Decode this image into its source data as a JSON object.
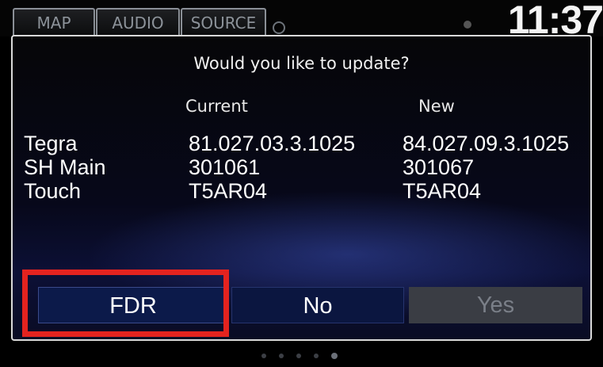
{
  "tabs": {
    "map": "MAP",
    "audio": "AUDIO",
    "source": "SOURCE"
  },
  "clock": "11:37",
  "dialog": {
    "question": "Would you like to update?",
    "current_header": "Current",
    "new_header": "New",
    "rows": [
      {
        "name": "Tegra",
        "current": "81.027.03.3.1025",
        "new": "84.027.09.3.1025"
      },
      {
        "name": "SH Main",
        "current": "301061",
        "new": "301067"
      },
      {
        "name": "Touch",
        "current": "T5AR04",
        "new": "T5AR04"
      }
    ]
  },
  "buttons": {
    "fdr": "FDR",
    "no": "No",
    "yes": "Yes"
  },
  "colors": {
    "highlight": "#e4231f",
    "button_blue": "#0c1a4a",
    "button_disabled": "#3a3d44"
  },
  "page_indicator": {
    "count": 5,
    "active_index": 4
  }
}
